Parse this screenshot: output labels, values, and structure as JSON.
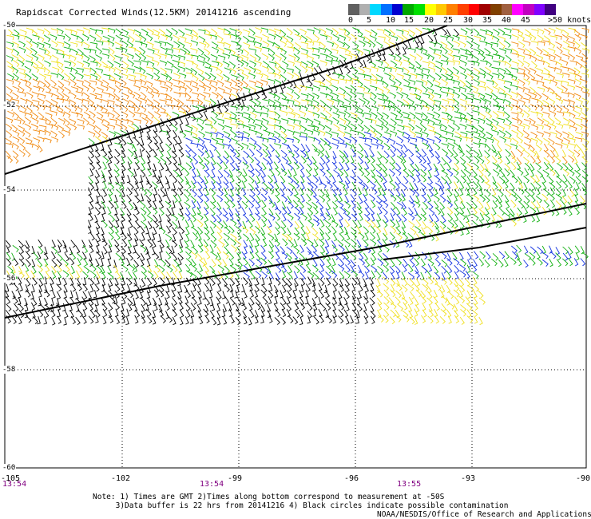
{
  "title": "Rapidscat Corrected Winds(12.5KM) 20141216 ascending",
  "legend": {
    "colors": [
      "#606060",
      "#b0b0b0",
      "#00d8ff",
      "#0070ff",
      "#0000d0",
      "#00a800",
      "#00e000",
      "#ffff00",
      "#ffc800",
      "#ff8000",
      "#ff4000",
      "#ff0000",
      "#a00000",
      "#804000",
      "#a06040",
      "#ff00ff",
      "#c000c0",
      "#8000ff",
      "#400080"
    ],
    "labels": [
      "0",
      "5",
      "10",
      "15",
      "20",
      "25",
      "30",
      "35",
      "40",
      "45",
      ">50 knots"
    ]
  },
  "lat_labels": [
    "-50",
    "-52",
    "-54",
    "-56",
    "-58",
    "-60"
  ],
  "lon_labels": [
    "-105",
    "-102",
    "-99",
    "-96",
    "-93",
    "-90"
  ],
  "time_labels": [
    "13:54",
    "13:54",
    "13:55"
  ],
  "notes": "Note: 1) Times are GMT 2)Times along bottom correspond to measurement at -50S\n     3)Data buffer is 22 hrs from 20141216 4) Black circles indicate possible contamination",
  "credit": "NOAA/NESDIS/Office of Research and Applications",
  "colors": {
    "black": "#000000",
    "blue": "#1030e0",
    "green": "#10b010",
    "yellow": "#f0e020",
    "orange": "#f08a10",
    "gridline": "#000000"
  }
}
